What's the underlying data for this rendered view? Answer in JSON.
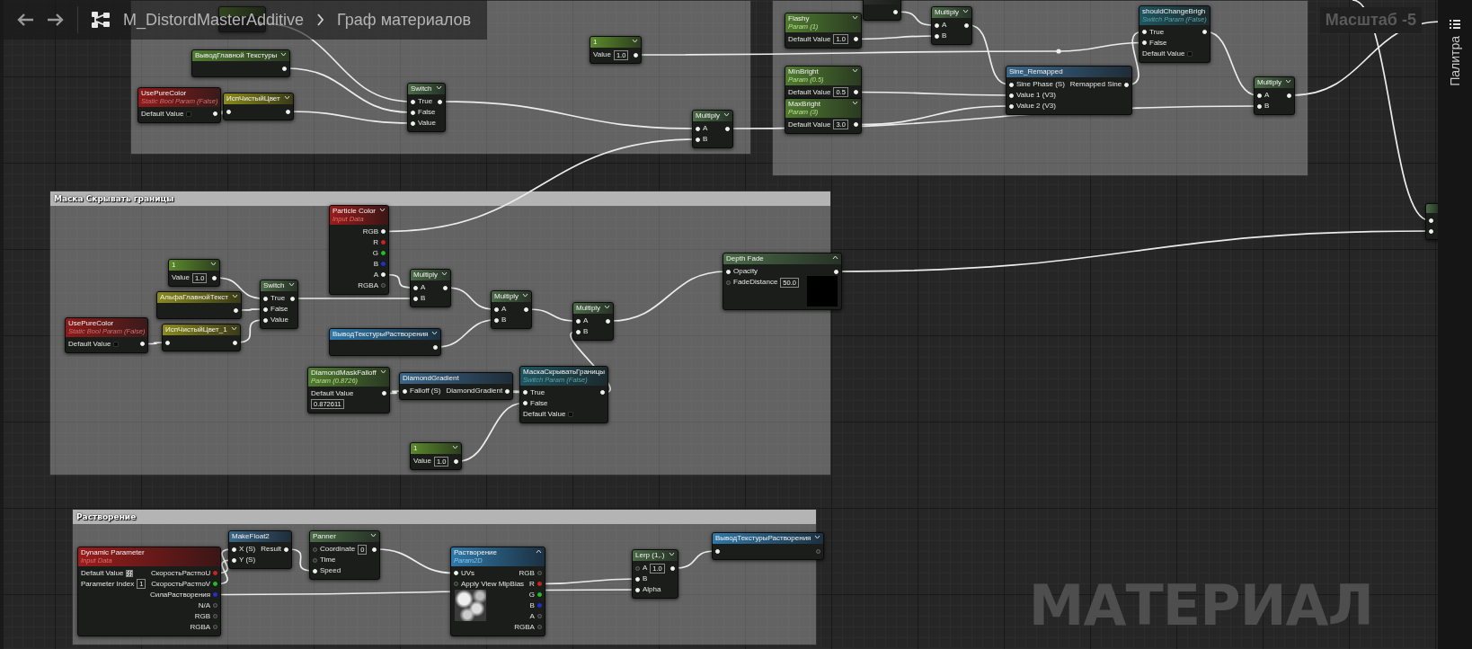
{
  "toolbar": {
    "path": [
      "M_DistordMasterAdditive",
      "Граф материалов"
    ],
    "zoom": "Масштаб -5"
  },
  "palette": {
    "label": "Палитра"
  },
  "comments": [
    {
      "kind": "plain"
    },
    {
      "kind": "plain"
    },
    {
      "kind": "titled",
      "title": "Маска Скрывать границы"
    },
    {
      "kind": "titled",
      "title": "Растворение"
    }
  ],
  "nodes": [
    {
      "kind": "constant",
      "rows": [
        {
          "in_pin": false,
          "out_pin": true
        }
      ]
    },
    {
      "kind": "parameter",
      "title": "ВыводГлавной Текстуры",
      "expanded": false,
      "rows": [
        {
          "in_pin": false,
          "out_pin": true
        }
      ]
    },
    {
      "kind": "boolean",
      "title": "UsePureColor",
      "subtitle": "Static Bool Param (False)",
      "rows": [
        {
          "in_pin": false,
          "out_pin": true,
          "label": "Default Value",
          "kind": "checkbox",
          "checked": false
        }
      ]
    },
    {
      "kind": "named",
      "title": "ИспЧистыйЦвет",
      "expanded": false,
      "rows": [
        {
          "in_pin": true,
          "out_pin": true
        }
      ]
    },
    {
      "kind": "math",
      "title": "Switch",
      "expanded": false,
      "rows": [
        {
          "in_pin": true,
          "out_pin": true,
          "label": "True"
        },
        {
          "in_pin": true,
          "out_pin": false,
          "label": "False"
        },
        {
          "in_pin": true,
          "out_pin": false,
          "label": "Value"
        }
      ]
    },
    {
      "kind": "constant",
      "title": "1",
      "expanded": false,
      "rows": [
        {
          "in_pin": false,
          "out_pin": true,
          "label": "Value",
          "kind": "field",
          "value": "1.0"
        }
      ]
    },
    {
      "kind": "math",
      "title": "Multiply",
      "expanded": false,
      "rows": [
        {
          "in_pin": true,
          "out_pin": true,
          "label": "A"
        },
        {
          "in_pin": true,
          "out_pin": false,
          "label": "B"
        }
      ]
    },
    {
      "kind": "parameter",
      "title": "Flashy",
      "subtitle": "Param (1)",
      "expanded": false,
      "rows": [
        {
          "in_pin": false,
          "out_pin": true,
          "label": "Default Value",
          "kind": "field",
          "value": "1.0"
        }
      ]
    },
    {
      "kind": "dark",
      "rows": [
        {
          "in_pin": false,
          "out_pin": true
        }
      ]
    },
    {
      "kind": "math",
      "title": "Multiply",
      "expanded": false,
      "rows": [
        {
          "in_pin": true,
          "out_pin": true,
          "label": "A"
        },
        {
          "in_pin": true,
          "out_pin": false,
          "label": "B"
        }
      ]
    },
    {
      "kind": "switch",
      "title": "shouldChangeBrigh",
      "subtitle": "Switch Param (False)",
      "rows": [
        {
          "in_pin": true,
          "out_pin": true,
          "label": "True"
        },
        {
          "in_pin": true,
          "out_pin": false,
          "label": "False"
        },
        {
          "in_pin": false,
          "out_pin": false,
          "label": "Default Value",
          "kind": "checkbox",
          "checked": false
        }
      ]
    },
    {
      "kind": "parameter",
      "title": "MinBright",
      "subtitle": "Param (0.5)",
      "expanded": false,
      "rows": [
        {
          "in_pin": false,
          "out_pin": true,
          "label": "Default Value",
          "kind": "field",
          "value": "0.5"
        }
      ]
    },
    {
      "kind": "parameter",
      "title": "MaxBright",
      "subtitle": "Param (3)",
      "expanded": false,
      "rows": [
        {
          "in_pin": false,
          "out_pin": true,
          "label": "Default Value",
          "kind": "field",
          "value": "3.0"
        }
      ]
    },
    {
      "kind": "function",
      "title": "Sine_Remapped",
      "rows": [
        {
          "in_pin": true,
          "out_pin": true,
          "label": "Sine Phase (S)",
          "out": "Remapped Sine"
        },
        {
          "in_pin": true,
          "out_pin": false,
          "label": "Value 1 (V3)"
        },
        {
          "in_pin": true,
          "out_pin": false,
          "label": "Value 2 (V3)"
        }
      ]
    },
    {
      "kind": "math",
      "title": "Multiply",
      "expanded": false,
      "rows": [
        {
          "in_pin": true,
          "out_pin": true,
          "label": "A"
        },
        {
          "in_pin": true,
          "out_pin": false,
          "label": "B"
        }
      ]
    },
    {
      "kind": "math",
      "rows": [
        {
          "in_pin": true,
          "out_pin": false
        },
        {
          "in_pin": true,
          "out_pin": false
        }
      ]
    },
    {
      "kind": "constant",
      "title": "1",
      "expanded": false,
      "rows": [
        {
          "in_pin": false,
          "out_pin": true,
          "label": "Value",
          "kind": "field",
          "value": "1.0"
        }
      ]
    },
    {
      "kind": "named",
      "title": "АльфаГлавнойТекст",
      "expanded": false,
      "rows": [
        {
          "in_pin": false,
          "out_pin": true
        }
      ]
    },
    {
      "kind": "boolean",
      "title": "UsePureColor",
      "subtitle": "Static Bool Param (False)",
      "rows": [
        {
          "in_pin": false,
          "out_pin": true,
          "label": "Default Value",
          "kind": "checkbox",
          "checked": false
        }
      ]
    },
    {
      "kind": "named",
      "title": "ИспЧистыйЦвет_1",
      "expanded": false,
      "rows": [
        {
          "in_pin": true,
          "out_pin": true
        }
      ]
    },
    {
      "kind": "math",
      "title": "Switch",
      "expanded": false,
      "rows": [
        {
          "in_pin": true,
          "out_pin": true,
          "label": "True"
        },
        {
          "in_pin": true,
          "out_pin": false,
          "label": "False"
        },
        {
          "in_pin": true,
          "out_pin": false,
          "label": "Value"
        }
      ]
    },
    {
      "kind": "input",
      "title": "Particle Color",
      "subtitle": "Input Data",
      "expanded": false,
      "rows": [
        {
          "in_pin": false,
          "out_pin": true,
          "out": "RGB"
        },
        {
          "in_pin": false,
          "out_pin": true,
          "out": "R",
          "color": "#d02020"
        },
        {
          "in_pin": false,
          "out_pin": true,
          "out": "G",
          "color": "#20c020"
        },
        {
          "in_pin": false,
          "out_pin": true,
          "out": "B",
          "color": "#2030d0"
        },
        {
          "in_pin": false,
          "out_pin": true,
          "out": "A"
        },
        {
          "in_pin": false,
          "out_pin": true,
          "out": "RGBA"
        }
      ]
    },
    {
      "kind": "math",
      "title": "Multiply",
      "expanded": false,
      "rows": [
        {
          "in_pin": true,
          "out_pin": true,
          "label": "A"
        },
        {
          "in_pin": true,
          "out_pin": false,
          "label": "B"
        }
      ]
    },
    {
      "kind": "texture",
      "title": "ВыводТекстурыРастворения",
      "expanded": false,
      "rows": [
        {
          "in_pin": false,
          "out_pin": true
        }
      ]
    },
    {
      "kind": "parameter",
      "title": "DiamondMaskFalloff",
      "subtitle": "Param (0.8726)",
      "expanded": false,
      "rows": [
        {
          "in_pin": false,
          "out_pin": true,
          "label": "Default Value"
        },
        {
          "in_pin": false,
          "out_pin": false,
          "kind": "field",
          "value": "0.872611"
        }
      ]
    },
    {
      "kind": "function",
      "title": "DiamondGradient",
      "rows": [
        {
          "in_pin": true,
          "out_pin": true,
          "label": "Falloff (S)",
          "out": "DiamondGradient"
        }
      ]
    },
    {
      "kind": "constant",
      "title": "1",
      "expanded": false,
      "rows": [
        {
          "in_pin": false,
          "out_pin": true,
          "label": "Value",
          "kind": "field",
          "value": "1.0"
        }
      ]
    },
    {
      "kind": "math",
      "title": "Multiply",
      "expanded": false,
      "rows": [
        {
          "in_pin": true,
          "out_pin": true,
          "label": "A"
        },
        {
          "in_pin": true,
          "out_pin": false,
          "label": "B"
        }
      ]
    },
    {
      "kind": "math",
      "title": "Multiply",
      "expanded": false,
      "rows": [
        {
          "in_pin": true,
          "out_pin": true,
          "label": "A"
        },
        {
          "in_pin": true,
          "out_pin": false,
          "label": "B"
        }
      ]
    },
    {
      "kind": "switch",
      "title": "МаскаСкрыватьГраницы",
      "subtitle": "Switch Param (False)",
      "rows": [
        {
          "in_pin": true,
          "out_pin": true,
          "label": "True"
        },
        {
          "in_pin": true,
          "out_pin": false,
          "label": "False"
        },
        {
          "in_pin": false,
          "out_pin": false,
          "label": "Default Value",
          "kind": "checkbox",
          "checked": false
        }
      ]
    },
    {
      "kind": "math",
      "title": "Depth Fade",
      "expanded": true,
      "preview": true,
      "rows": [
        {
          "in_pin": true,
          "out_pin": true,
          "label": "Opacity"
        },
        {
          "in_pin": true,
          "out_pin": false,
          "label": "FadeDistance",
          "kind": "field",
          "value": "50.0"
        }
      ]
    },
    {
      "kind": "input",
      "title": "Dynamic Parameter",
      "subtitle": "Input Data",
      "rows": [
        {
          "in_pin": false,
          "out_pin": true,
          "label": "Default Value",
          "kind": "swatch",
          "out": "СкоростьРастпоU",
          "color": "#d02020"
        },
        {
          "in_pin": false,
          "out_pin": true,
          "label": "Parameter Index",
          "kind": "field",
          "value": "1",
          "out": "СкоростьРастпоV",
          "color": "#20c020"
        },
        {
          "in_pin": false,
          "out_pin": true,
          "out": "СилаРастворения",
          "color": "#2030d0"
        },
        {
          "in_pin": false,
          "out_pin": true,
          "out": "N/A"
        },
        {
          "in_pin": false,
          "out_pin": true,
          "out": "RGB"
        },
        {
          "in_pin": false,
          "out_pin": true,
          "out": "RGBA"
        }
      ]
    },
    {
      "kind": "function",
      "title": "MakeFloat2",
      "rows": [
        {
          "in_pin": true,
          "out_pin": true,
          "label": "X (S)",
          "out": "Result"
        },
        {
          "in_pin": true,
          "out_pin": false,
          "label": "Y (S)"
        }
      ]
    },
    {
      "kind": "math",
      "title": "Panner",
      "expanded": false,
      "rows": [
        {
          "in_pin": true,
          "out_pin": true,
          "label": "Coordinate",
          "kind": "field",
          "value": "0"
        },
        {
          "in_pin": true,
          "out_pin": false,
          "label": "Time"
        },
        {
          "in_pin": true,
          "out_pin": false,
          "label": "Speed"
        }
      ]
    },
    {
      "kind": "texture",
      "title": "Растворение",
      "subtitle": "Param2D",
      "expanded": true,
      "preview": true,
      "rows": [
        {
          "in_pin": true,
          "out_pin": true,
          "label": "UVs",
          "out": "RGB"
        },
        {
          "in_pin": true,
          "out_pin": true,
          "label": "Apply View MipBias",
          "out": "R",
          "color": "#d02020"
        },
        {
          "in_pin": false,
          "out_pin": true,
          "out": "G",
          "color": "#20c020"
        },
        {
          "in_pin": false,
          "out_pin": true,
          "out": "B",
          "color": "#2030d0"
        },
        {
          "in_pin": false,
          "out_pin": true,
          "out": "A"
        },
        {
          "in_pin": false,
          "out_pin": true,
          "out": "RGBA"
        }
      ]
    },
    {
      "kind": "math",
      "title": "Lerp (1,.)",
      "expanded": false,
      "rows": [
        {
          "in_pin": true,
          "out_pin": true,
          "label": "A",
          "kind": "field",
          "value": "1.0"
        },
        {
          "in_pin": true,
          "out_pin": false,
          "label": "B"
        },
        {
          "in_pin": true,
          "out_pin": false,
          "label": "Alpha"
        }
      ]
    },
    {
      "kind": "texture",
      "title": "ВыводТекстурыРастворения",
      "expanded": false,
      "rows": [
        {
          "in_pin": true,
          "out_pin": true
        }
      ]
    }
  ],
  "graph_label": "МАТЕРИАЛ"
}
